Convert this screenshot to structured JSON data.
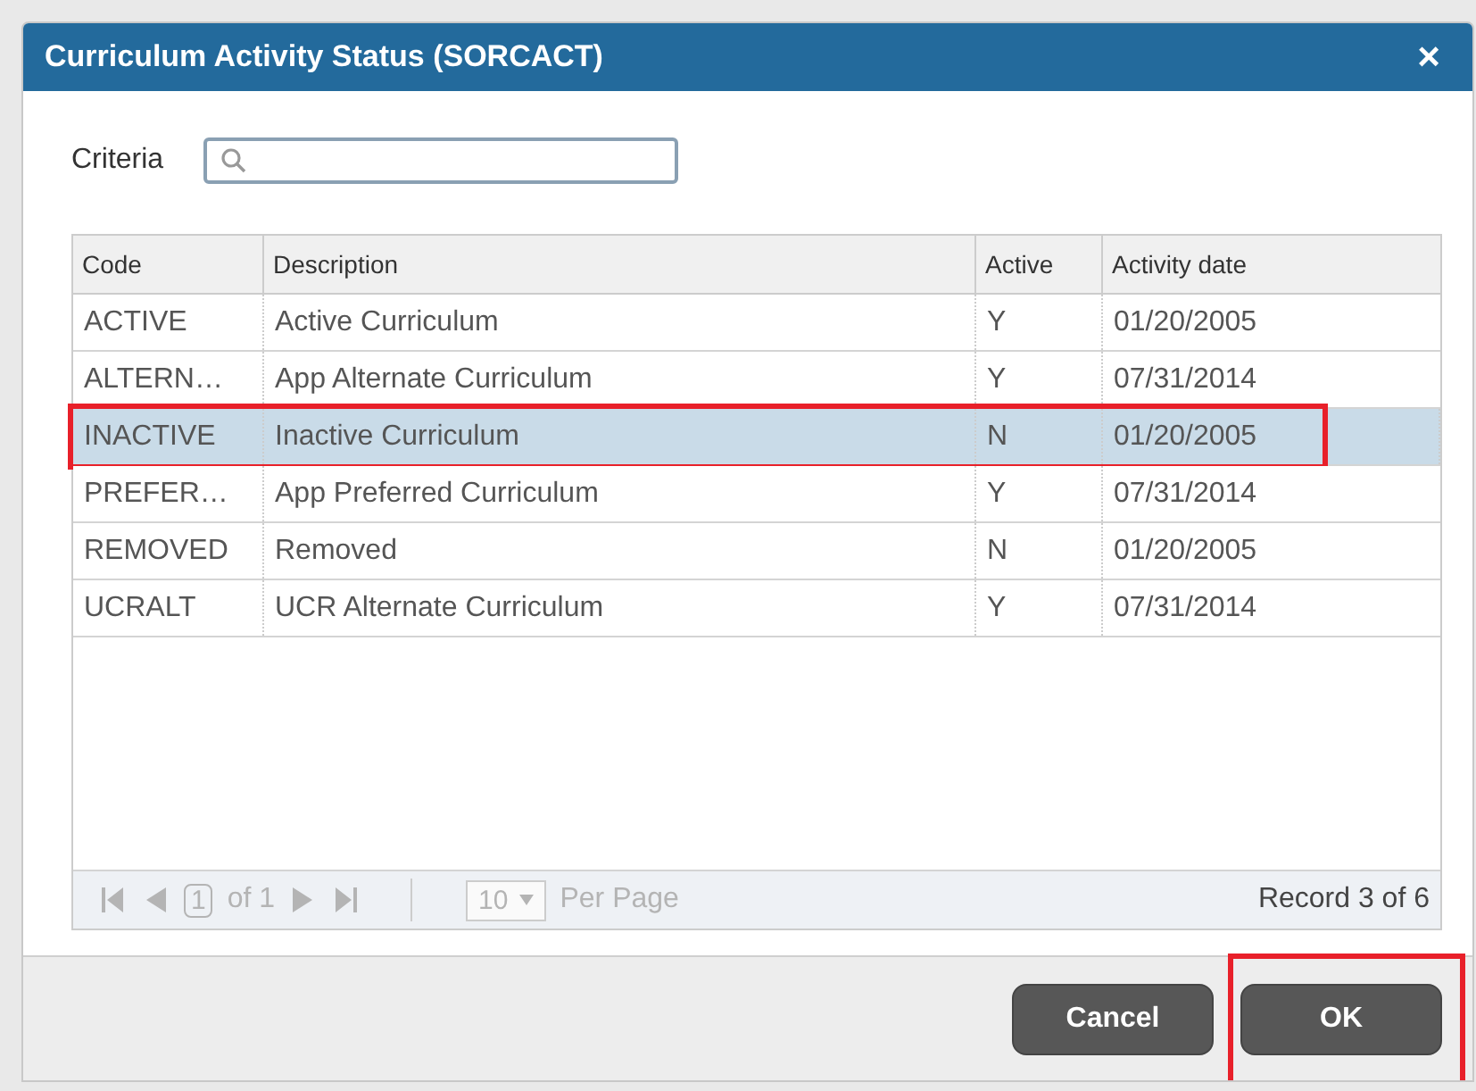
{
  "dialog": {
    "title": "Curriculum Activity Status (SORCACT)",
    "close": "×"
  },
  "criteria": {
    "label": "Criteria"
  },
  "table": {
    "columns": [
      "Code",
      "Description",
      "Active",
      "Activity date"
    ],
    "rows": [
      {
        "cells": [
          "ACTIVE",
          "Active Curriculum",
          "Y",
          "01/20/2005"
        ],
        "selected": false,
        "highlighted": false
      },
      {
        "cells": [
          "ALTERN…",
          "App Alternate Curriculum",
          "Y",
          "07/31/2014"
        ],
        "selected": false,
        "highlighted": false
      },
      {
        "cells": [
          "INACTIVE",
          "Inactive Curriculum",
          "N",
          "01/20/2005"
        ],
        "selected": true,
        "highlighted": true
      },
      {
        "cells": [
          "PREFER…",
          "App Preferred Curriculum",
          "Y",
          "07/31/2014"
        ],
        "selected": false,
        "highlighted": false
      },
      {
        "cells": [
          "REMOVED",
          "Removed",
          "N",
          "01/20/2005"
        ],
        "selected": false,
        "highlighted": false
      },
      {
        "cells": [
          "UCRALT",
          "UCR Alternate Curriculum",
          "Y",
          "07/31/2014"
        ],
        "selected": false,
        "highlighted": false
      }
    ]
  },
  "pager": {
    "page": "1",
    "of": "of 1",
    "page_size": "10",
    "per_page": "Per Page",
    "record": "Record 3 of 6",
    "disabled": true
  },
  "buttons": [
    {
      "label": "Cancel",
      "highlighted": false
    },
    {
      "label": "OK",
      "highlighted": true
    }
  ]
}
